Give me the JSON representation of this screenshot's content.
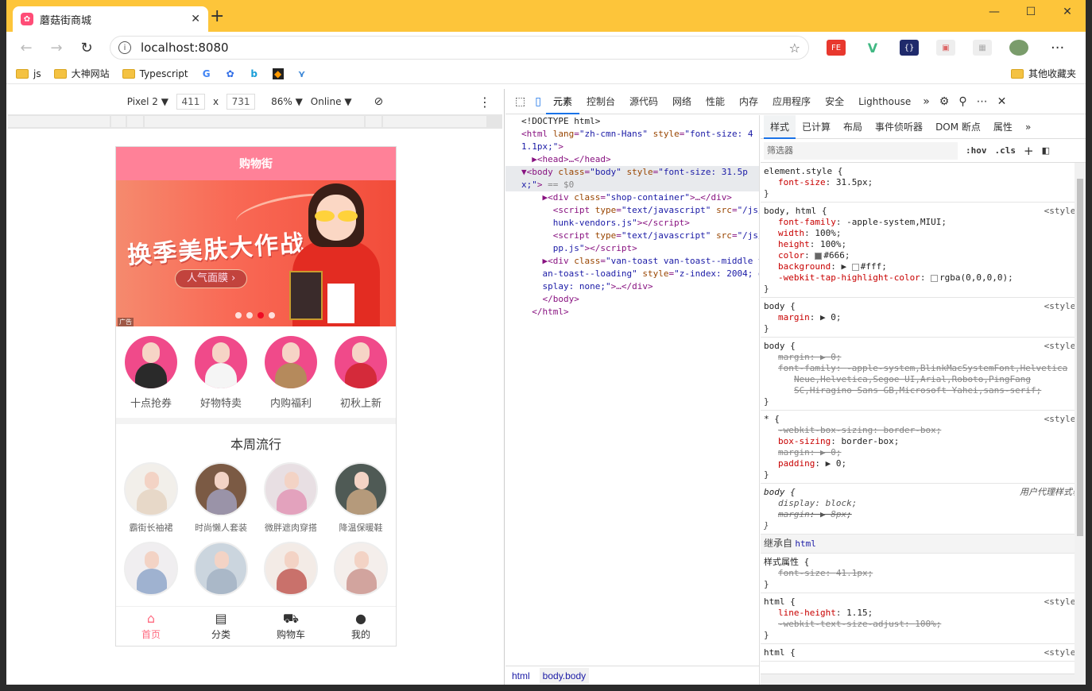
{
  "browser": {
    "tab_title": "蘑菇街商城",
    "url": "localhost:8080",
    "bookmarks": [
      "js",
      "大神网站",
      "Typescript"
    ],
    "other_bookmarks": "其他收藏夹"
  },
  "device_toolbar": {
    "device": "Pixel 2 ▼",
    "width": "411",
    "times": "x",
    "height": "731",
    "zoom": "86% ▼",
    "network": "Online ▼"
  },
  "app": {
    "header_title": "购物街",
    "banner": {
      "headline": "换季美肤大作战",
      "pill": "人气面膜 ›",
      "ad_tag": "广告",
      "active_dot": 3,
      "dot_count": 4
    },
    "categories": [
      {
        "label": "十点抢券"
      },
      {
        "label": "好物特卖"
      },
      {
        "label": "内购福利"
      },
      {
        "label": "初秋上新"
      }
    ],
    "weekly_title": "本周流行",
    "weekly_items": [
      {
        "label": "霸街长袖裙"
      },
      {
        "label": "时尚懒人套装"
      },
      {
        "label": "微胖遮肉穿搭"
      },
      {
        "label": "降温保暖鞋"
      },
      {
        "label": ""
      },
      {
        "label": ""
      },
      {
        "label": ""
      },
      {
        "label": ""
      }
    ],
    "tabbar": [
      {
        "label": "首页"
      },
      {
        "label": "分类"
      },
      {
        "label": "购物车"
      },
      {
        "label": "我的"
      }
    ]
  },
  "devtools": {
    "tabs": [
      "元素",
      "控制台",
      "源代码",
      "网络",
      "性能",
      "内存",
      "应用程序",
      "安全",
      "Lighthouse"
    ],
    "styles_tabs": [
      "样式",
      "已计算",
      "布局",
      "事件侦听器",
      "DOM 断点",
      "属性"
    ],
    "filter_placeholder": "筛选器",
    "hov": ":hov",
    "cls": ".cls",
    "breadcrumb": [
      "html",
      "body.body"
    ],
    "inherited_label": "继承自",
    "inherited_from": "html",
    "style_attr_label": "样式属性",
    "user_agent_label": "用户代理样式表",
    "style_source": "<style>"
  }
}
